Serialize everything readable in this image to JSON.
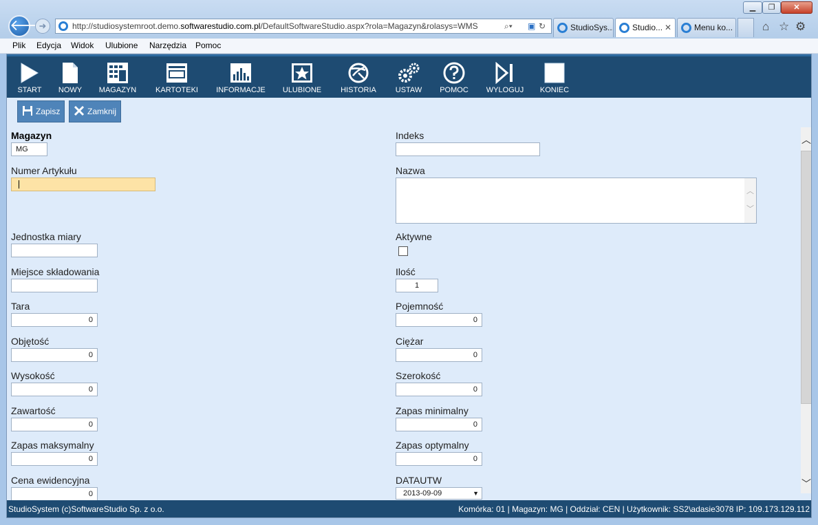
{
  "browser": {
    "address": "http://studiosystemroot.demo.softwarestudio.com.pl/DefaultSoftwareStudio.aspx?rola=Magazyn&rolasys=WMS",
    "address_pre": "http://studiosystemroot.demo.",
    "address_host": "softwarestudio.com.pl",
    "address_post": "/DefaultSoftwareStudio.aspx?rola=Magazyn&rolasys=WMS",
    "tabs": [
      {
        "label": "StudioSys..."
      },
      {
        "label": "Studio..."
      },
      {
        "label": "Menu ko..."
      }
    ],
    "menu": [
      "Plik",
      "Edycja",
      "Widok",
      "Ulubione",
      "Narzędzia",
      "Pomoc"
    ]
  },
  "toolbar": [
    {
      "label": "START",
      "icon": "play-icon"
    },
    {
      "label": "NOWY",
      "icon": "new-document-icon"
    },
    {
      "label": "MAGAZYN",
      "icon": "warehouse-grid-icon"
    },
    {
      "label": "KARTOTEKI",
      "icon": "card-file-icon"
    },
    {
      "label": "INFORMACJE",
      "icon": "bar-chart-icon"
    },
    {
      "label": "ULUBIONE",
      "icon": "star-icon"
    },
    {
      "label": "HISTORIA",
      "icon": "history-icon"
    },
    {
      "label": "USTAW",
      "icon": "gears-icon"
    },
    {
      "label": "POMOC",
      "icon": "help-icon"
    },
    {
      "label": "WYLOGUJ",
      "icon": "logout-icon"
    },
    {
      "label": "KONIEC",
      "icon": "stop-icon"
    }
  ],
  "actions": {
    "save": "Zapisz",
    "close": "Zamknij"
  },
  "form": {
    "magazyn": {
      "label": "Magazyn",
      "value": "MG"
    },
    "indeks": {
      "label": "Indeks",
      "value": ""
    },
    "numer_artykulu": {
      "label": "Numer Artykułu",
      "value": ""
    },
    "nazwa": {
      "label": "Nazwa",
      "value": ""
    },
    "jednostka_miary": {
      "label": "Jednostka miary",
      "value": ""
    },
    "aktywne": {
      "label": "Aktywne",
      "checked": false
    },
    "miejsce_skladowania": {
      "label": "Miejsce składowania",
      "value": ""
    },
    "ilosc": {
      "label": "Ilość",
      "value": "1"
    },
    "tara": {
      "label": "Tara",
      "value": "0"
    },
    "pojemnosc": {
      "label": "Pojemność",
      "value": "0"
    },
    "objetosc": {
      "label": "Objętość",
      "value": "0"
    },
    "ciezar": {
      "label": "Ciężar",
      "value": "0"
    },
    "wysokosc": {
      "label": "Wysokość",
      "value": "0"
    },
    "szerokosc": {
      "label": "Szerokość",
      "value": "0"
    },
    "zawartosc": {
      "label": "Zawartość",
      "value": "0"
    },
    "zapas_minimalny": {
      "label": "Zapas minimalny",
      "value": "0"
    },
    "zapas_maksymalny": {
      "label": "Zapas maksymalny",
      "value": "0"
    },
    "zapas_optymalny": {
      "label": "Zapas optymalny",
      "value": "0"
    },
    "cena_ewidencyjna": {
      "label": "Cena ewidencyjna",
      "value": "0"
    },
    "datautw": {
      "label": "DATAUTW",
      "value": "2013-09-09"
    }
  },
  "status": {
    "left": "StudioSystem (c)SoftwareStudio Sp. z o.o.",
    "right": "Komórka: 01 | Magazyn: MG | Oddział: CEN | Użytkownik: SS2\\adasie3078 IP: 109.173.129.112"
  }
}
